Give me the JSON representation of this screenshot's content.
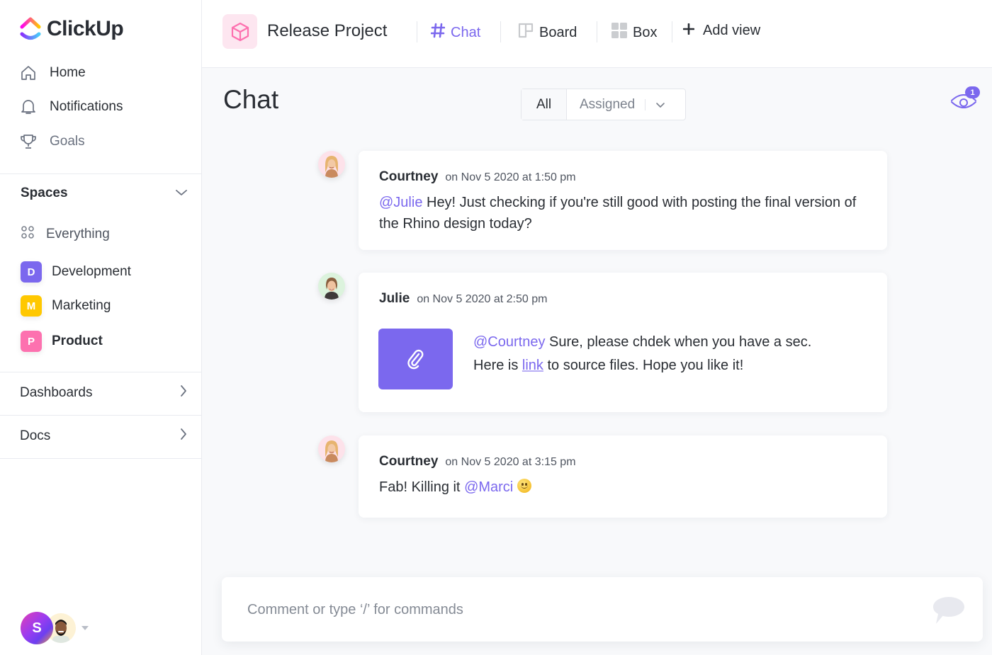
{
  "app": {
    "name": "ClickUp",
    "brand_color": "#7b68ee"
  },
  "sidebar": {
    "nav": [
      {
        "label": "Home",
        "icon": "home-icon"
      },
      {
        "label": "Notifications",
        "icon": "bell-icon"
      },
      {
        "label": "Goals",
        "icon": "trophy-icon"
      }
    ],
    "spaces": {
      "title": "Spaces",
      "everything_label": "Everything",
      "items": [
        {
          "letter": "D",
          "label": "Development",
          "color": "#7b68ee"
        },
        {
          "letter": "M",
          "label": "Marketing",
          "color": "#ffc800"
        },
        {
          "letter": "P",
          "label": "Product",
          "color": "#fd71af"
        }
      ]
    },
    "sections": [
      {
        "label": "Dashboards"
      },
      {
        "label": "Docs"
      }
    ],
    "user": {
      "initial": "S"
    }
  },
  "topbar": {
    "project_title": "Release Project",
    "views": [
      {
        "label": "Chat",
        "icon": "hash-icon",
        "active": true
      },
      {
        "label": "Board",
        "icon": "board-icon",
        "active": false
      },
      {
        "label": "Box",
        "icon": "box-grid-icon",
        "active": false
      }
    ],
    "add_view_label": "Add view"
  },
  "main": {
    "title": "Chat",
    "filters": {
      "all_label": "All",
      "assigned_label": "Assigned"
    },
    "watchers_count": "1",
    "messages": [
      {
        "author": "Courtney",
        "time": "on Nov 5 2020 at 1:50 pm",
        "mention": "@Julie",
        "text": " Hey! Just checking if you're still good with posting the final version of the Rhino design today?"
      },
      {
        "author": "Julie",
        "time": "on Nov 5 2020 at 2:50 pm",
        "mention": "@Courtney",
        "text_line1": " Sure, please chdek when you have a sec.",
        "text_line2_pre": "Here is ",
        "link_label": "link",
        "text_line2_post": " to source files. Hope you like it!",
        "has_attachment": true
      },
      {
        "author": "Courtney",
        "time": "on Nov 5 2020 at 3:15 pm",
        "text_pre": "Fab! Killing it ",
        "mention": "@Marci",
        "emoji": "slightly-smiling-face"
      }
    ],
    "composer": {
      "placeholder": "Comment or type ‘/’ for commands",
      "value": ""
    }
  }
}
